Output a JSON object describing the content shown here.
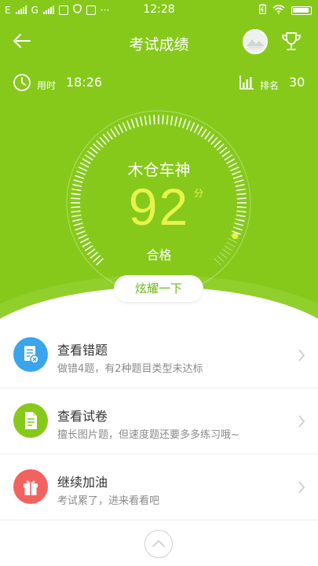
{
  "status_bar": {
    "carrier_1": "E",
    "carrier_2": "G",
    "time": "12:28",
    "dots": "···"
  },
  "nav": {
    "title": "考试成绩",
    "back_icon": "arrow-left-icon",
    "trophy_icon": "trophy-icon"
  },
  "stats": {
    "time_label": "用时",
    "time_value": "18:26",
    "rank_label": "排名",
    "rank_value": "30"
  },
  "result": {
    "title": "木仓车神",
    "score": "92",
    "unit": "分",
    "grade": "合格",
    "score_fraction": 0.92,
    "share_label": "炫耀一下"
  },
  "menu": [
    {
      "title": "查看错题",
      "subtitle": "做错4题，有2种题目类型未达标",
      "icon": "wrong-questions-icon",
      "color": "#3aa4ec"
    },
    {
      "title": "查看试卷",
      "subtitle": "擅长图片题，但速度题还要多多练习哦~",
      "icon": "document-icon",
      "color": "#86c91b"
    },
    {
      "title": "继续加油",
      "subtitle": "考试累了，进来看看吧",
      "icon": "gift-icon",
      "color": "#f2625f"
    }
  ],
  "colors": {
    "primary": "#86c91b",
    "score": "#e7f34b",
    "blue": "#3aa4ec",
    "red": "#f2625f"
  }
}
